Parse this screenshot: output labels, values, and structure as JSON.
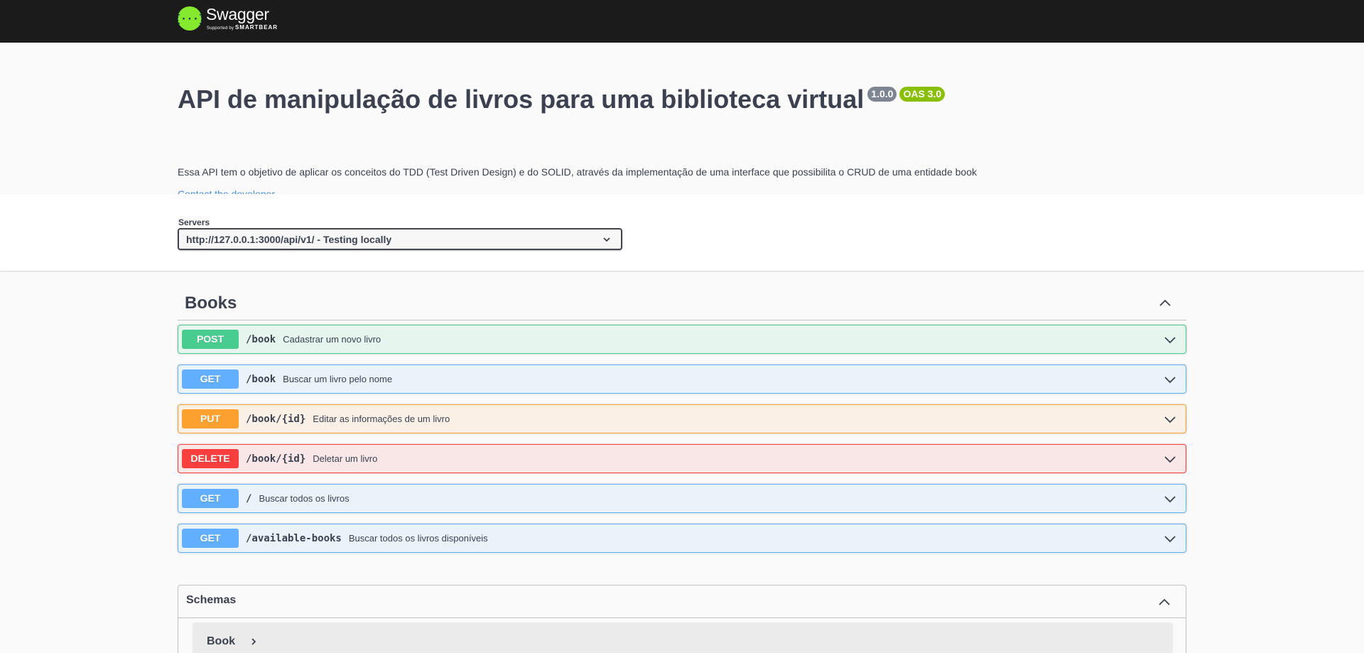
{
  "topbar": {
    "logo_name": "Swagger",
    "logo_sub_prefix": "Supported by",
    "logo_sub_brand": "SMARTBEAR",
    "logo_icon": "swagger-braces-icon",
    "colors": {
      "background": "#1b1b1b",
      "logo_green": "#85ea2d"
    }
  },
  "info": {
    "title": "API de manipulação de livros para uma biblioteca virtual",
    "version": "1.0.0",
    "oas": "OAS 3.0",
    "description": "Essa API tem o objetivo de aplicar os conceitos do TDD (Test Driven Design) e do SOLID, através da implementação de uma interface que possibilita o CRUD de uma entidade book",
    "contact": "Contact the developer"
  },
  "servers": {
    "label": "Servers",
    "selected": "http://127.0.0.1:3000/api/v1/ - Testing locally",
    "icon": "chevron-down-icon"
  },
  "tag": {
    "name": "Books",
    "toggle_icon": "chevron-up-icon",
    "operations": [
      {
        "method": "POST",
        "path": "/book",
        "summary": "Cadastrar um novo livro"
      },
      {
        "method": "GET",
        "path": "/book",
        "summary": "Buscar um livro pelo nome"
      },
      {
        "method": "PUT",
        "path": "/book/{id}",
        "summary": "Editar as informações de um livro"
      },
      {
        "method": "DELETE",
        "path": "/book/{id}",
        "summary": "Deletar um livro"
      },
      {
        "method": "GET",
        "path": "/",
        "summary": "Buscar todos os livros"
      },
      {
        "method": "GET",
        "path": "/available-books",
        "summary": "Buscar todos os livros disponíveis"
      }
    ]
  },
  "method_colors": {
    "POST": "#49cc90",
    "GET": "#61affe",
    "PUT": "#fca130",
    "DELETE": "#f93e3e"
  },
  "schemas": {
    "title": "Schemas",
    "models": [
      {
        "name": "Book"
      }
    ]
  }
}
